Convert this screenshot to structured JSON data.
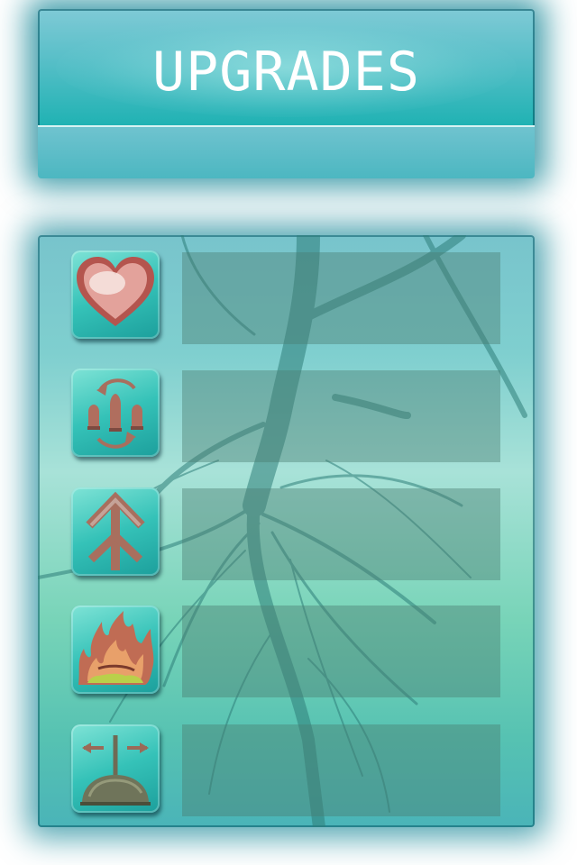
{
  "header": {
    "title": "UPGRADES"
  },
  "upgrades": [
    {
      "icon": "heart-icon",
      "description": ""
    },
    {
      "icon": "rotate-units-icon",
      "description": ""
    },
    {
      "icon": "arrow-up-icon",
      "description": ""
    },
    {
      "icon": "fire-icon",
      "description": ""
    },
    {
      "icon": "spread-helmet-icon",
      "description": ""
    }
  ],
  "colors": {
    "panel_teal": "#1fb2b3",
    "panel_light": "#a8e2d8",
    "glow": "#0880a1",
    "icon_red": "#b46a5e"
  }
}
